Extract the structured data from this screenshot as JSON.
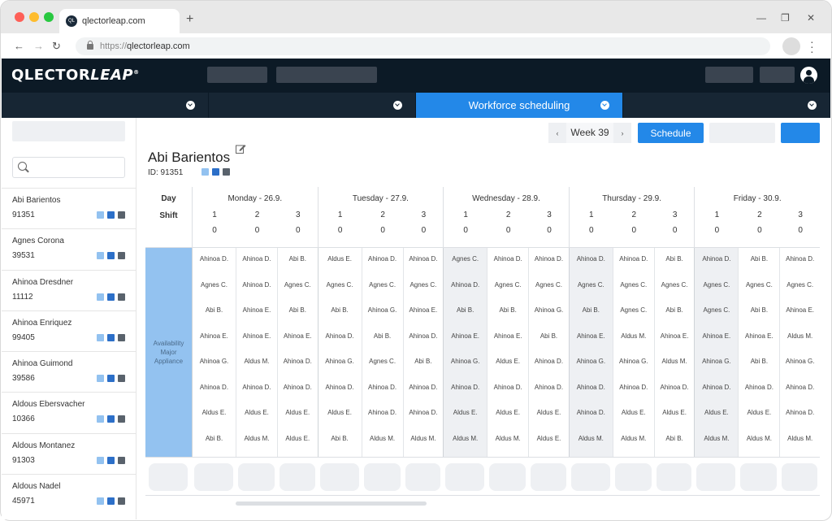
{
  "browser": {
    "tab_title": "qlectorleap.com",
    "favicon_text": "QL",
    "url_protocol": "https://",
    "url_host": "qlectorleap.com"
  },
  "app": {
    "logo_main": "QLECTOR",
    "logo_italic": "LEAP",
    "logo_mark": "®"
  },
  "modules": [
    {
      "label": ""
    },
    {
      "label": ""
    },
    {
      "label": "Workforce scheduling"
    },
    {
      "label": ""
    }
  ],
  "colors": {
    "accent": "#2388e8",
    "header_bg": "#0c1a26",
    "sq_light": "#93c2f0",
    "sq_mid": "#2c6fc8",
    "sq_dark": "#59626c"
  },
  "employees": [
    {
      "name": "Abi Barientos",
      "id": "91351"
    },
    {
      "name": "Agnes Corona",
      "id": "39531"
    },
    {
      "name": "Ahinoa Dresdner",
      "id": "11112"
    },
    {
      "name": "Ahinoa Enriquez",
      "id": "99405"
    },
    {
      "name": "Ahinoa Guimond",
      "id": "39586"
    },
    {
      "name": "Aldous Ebersvacher",
      "id": "10366"
    },
    {
      "name": "Aldous Montanez",
      "id": "91303"
    },
    {
      "name": "Aldous Nadel",
      "id": "45971"
    }
  ],
  "toolbar": {
    "prev": "‹",
    "next": "›",
    "week_label": "Week 39",
    "schedule_label": "Schedule"
  },
  "selected": {
    "name": "Abi Barientos",
    "id_label": "ID: 91351"
  },
  "grid": {
    "day_label": "Day",
    "shift_label": "Shift",
    "row_label": "Availability Major Appliance",
    "days": [
      {
        "title": "Monday - 26.9.",
        "shifts": [
          {
            "num": "1",
            "count": "0",
            "grey": false,
            "cells": [
              "Ahinoa D.",
              "Agnes C.",
              "Abi B.",
              "Ahinoa E.",
              "Ahinoa G.",
              "Ahinoa D.",
              "Aldus E.",
              "Abi B."
            ]
          },
          {
            "num": "2",
            "count": "0",
            "grey": false,
            "cells": [
              "Ahinoa D.",
              "Ahinoa D.",
              "Ahinoa E.",
              "Ahinoa E.",
              "Aldus M.",
              "Ahinoa D.",
              "Aldus E.",
              "Aldus M."
            ]
          },
          {
            "num": "3",
            "count": "0",
            "grey": false,
            "cells": [
              "Abi B.",
              "Agnes C.",
              "Abi B.",
              "Ahinoa E.",
              "Ahinoa D.",
              "Ahinoa D.",
              "Aldus E.",
              "Aldus E."
            ]
          }
        ]
      },
      {
        "title": "Tuesday - 27.9.",
        "shifts": [
          {
            "num": "1",
            "count": "0",
            "grey": false,
            "cells": [
              "Aldus E.",
              "Agnes C.",
              "Abi B.",
              "Ahinoa D.",
              "Ahinoa G.",
              "Ahinoa D.",
              "Aldus E.",
              "Abi B."
            ]
          },
          {
            "num": "2",
            "count": "0",
            "grey": false,
            "cells": [
              "Ahinoa D.",
              "Agnes C.",
              "Ahinoa G.",
              "Abi B.",
              "Agnes C.",
              "Ahinoa D.",
              "Ahinoa D.",
              "Aldus M."
            ]
          },
          {
            "num": "3",
            "count": "0",
            "grey": false,
            "cells": [
              "Ahinoa D.",
              "Agnes C.",
              "Ahinoa E.",
              "Ahinoa D.",
              "Abi B.",
              "Ahinoa D.",
              "Ahinoa D.",
              "Aldus M."
            ]
          }
        ]
      },
      {
        "title": "Wednesday - 28.9.",
        "shifts": [
          {
            "num": "1",
            "count": "0",
            "grey": true,
            "cells": [
              "Agnes C.",
              "Ahinoa D.",
              "Abi B.",
              "Ahinoa E.",
              "Ahinoa G.",
              "Ahinoa D.",
              "Aldus E.",
              "Aldus M."
            ]
          },
          {
            "num": "2",
            "count": "0",
            "grey": false,
            "cells": [
              "Ahinoa D.",
              "Agnes C.",
              "Abi B.",
              "Ahinoa E.",
              "Aldus E.",
              "Ahinoa D.",
              "Aldus E.",
              "Aldus M."
            ]
          },
          {
            "num": "3",
            "count": "0",
            "grey": false,
            "cells": [
              "Ahinoa D.",
              "Agnes C.",
              "Ahinoa G.",
              "Abi B.",
              "Ahinoa D.",
              "Ahinoa D.",
              "Aldus E.",
              "Aldus E."
            ]
          }
        ]
      },
      {
        "title": "Thursday - 29.9.",
        "shifts": [
          {
            "num": "1",
            "count": "0",
            "grey": true,
            "cells": [
              "Ahinoa D.",
              "Agnes C.",
              "Abi B.",
              "Ahinoa E.",
              "Ahinoa G.",
              "Ahinoa D.",
              "Ahinoa D.",
              "Aldus M."
            ]
          },
          {
            "num": "2",
            "count": "0",
            "grey": false,
            "cells": [
              "Ahinoa D.",
              "Agnes C.",
              "Agnes C.",
              "Aldus M.",
              "Ahinoa G.",
              "Ahinoa D.",
              "Aldus E.",
              "Aldus M."
            ]
          },
          {
            "num": "3",
            "count": "0",
            "grey": false,
            "cells": [
              "Abi B.",
              "Agnes C.",
              "Abi B.",
              "Ahinoa E.",
              "Aldus M.",
              "Ahinoa D.",
              "Aldus E.",
              "Abi B."
            ]
          }
        ]
      },
      {
        "title": "Friday - 30.9.",
        "shifts": [
          {
            "num": "1",
            "count": "0",
            "grey": true,
            "cells": [
              "Ahinoa D.",
              "Agnes C.",
              "Agnes C.",
              "Ahinoa E.",
              "Ahinoa G.",
              "Ahinoa D.",
              "Aldus E.",
              "Aldus M."
            ]
          },
          {
            "num": "2",
            "count": "0",
            "grey": false,
            "cells": [
              "Abi B.",
              "Agnes C.",
              "Abi B.",
              "Ahinoa E.",
              "Abi B.",
              "Ahinoa D.",
              "Aldus E.",
              "Aldus M."
            ]
          },
          {
            "num": "3",
            "count": "0",
            "grey": false,
            "cells": [
              "Ahinoa D.",
              "Agnes C.",
              "Ahinoa E.",
              "Aldus M.",
              "Ahinoa G.",
              "Ahinoa D.",
              "Ahinoa D.",
              "Aldus M."
            ]
          }
        ]
      }
    ]
  }
}
